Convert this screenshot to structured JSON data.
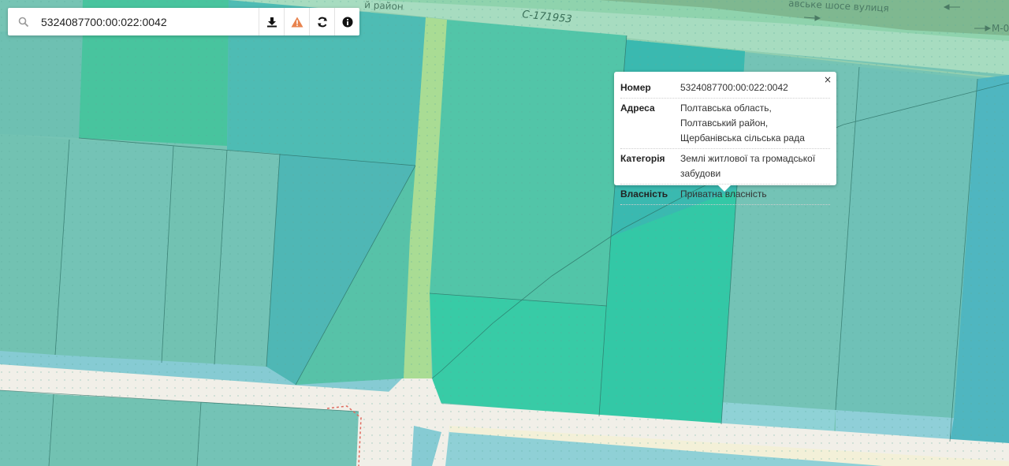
{
  "search": {
    "value": "5324087700:00:022:0042"
  },
  "toolbar": {
    "icons": [
      "search-icon",
      "download-icon",
      "warning-icon",
      "refresh-icon",
      "info-icon"
    ],
    "warning_color": "#e8834e"
  },
  "map": {
    "road_labels": {
      "district": "й район",
      "road_code": "С-171953",
      "street": "авське шосе вулиця",
      "highway": "М-0"
    }
  },
  "popup": {
    "close_label": "×",
    "rows": [
      {
        "key": "Номер",
        "value": "5324087700:00:022:0042"
      },
      {
        "key": "Адреса",
        "value": "Полтавська область, Полтавський район, Щербанівська сільська рада"
      },
      {
        "key": "Категорія",
        "value": "Землі житлової та громадської забудови"
      },
      {
        "key": "Власність",
        "value": "Приватна власність"
      }
    ]
  },
  "colors": {
    "parcel_base": "#72c2b2",
    "parcel_selected": "#2fc9a4",
    "road": "#f1efe8",
    "lane": "#a9dc94"
  }
}
